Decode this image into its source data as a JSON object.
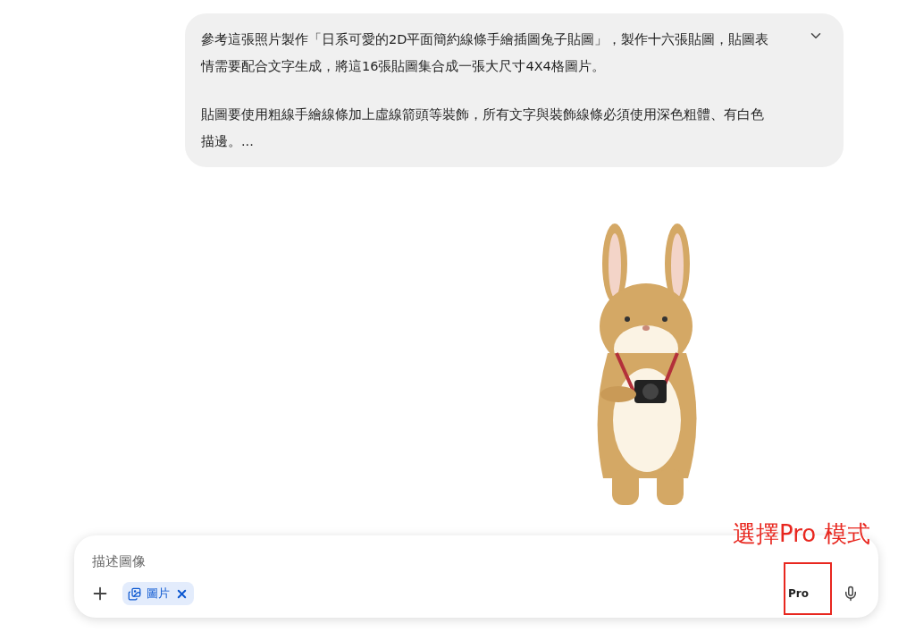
{
  "message": {
    "paragraphs": [
      "參考這張照片製作「日系可愛的2D平面簡約線條手繪插圖兔子貼圖」，製作十六張貼圖，貼圖表情需要配合文字生成，將這16張貼圖集合成一張大尺寸4X4格圖片。",
      "貼圖要使用粗線手繪線條加上虛線箭頭等裝飾，所有文字與裝飾線條必須使用深色粗體、有白色描邊。..."
    ],
    "expanded": false
  },
  "composer": {
    "placeholder": "描述圖像",
    "chip": {
      "label": "圖片"
    },
    "mode": "Pro"
  },
  "annotation": {
    "text": "選擇Pro 模式"
  }
}
